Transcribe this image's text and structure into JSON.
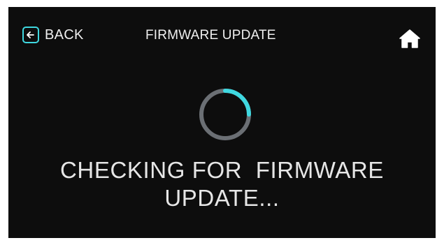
{
  "header": {
    "back_label": "BACK",
    "title": "FIRMWARE UPDATE",
    "back_icon": "arrow-left-icon",
    "home_icon": "home-icon"
  },
  "status": {
    "line1": "CHECKING FOR  FIRMWARE",
    "line2": "UPDATE...",
    "progress_fraction": 0.25
  },
  "colors": {
    "accent": "#3fd8e0",
    "background": "#0d0d0d",
    "text": "#e8e8e8",
    "spinner_track": "#6b6f74"
  }
}
